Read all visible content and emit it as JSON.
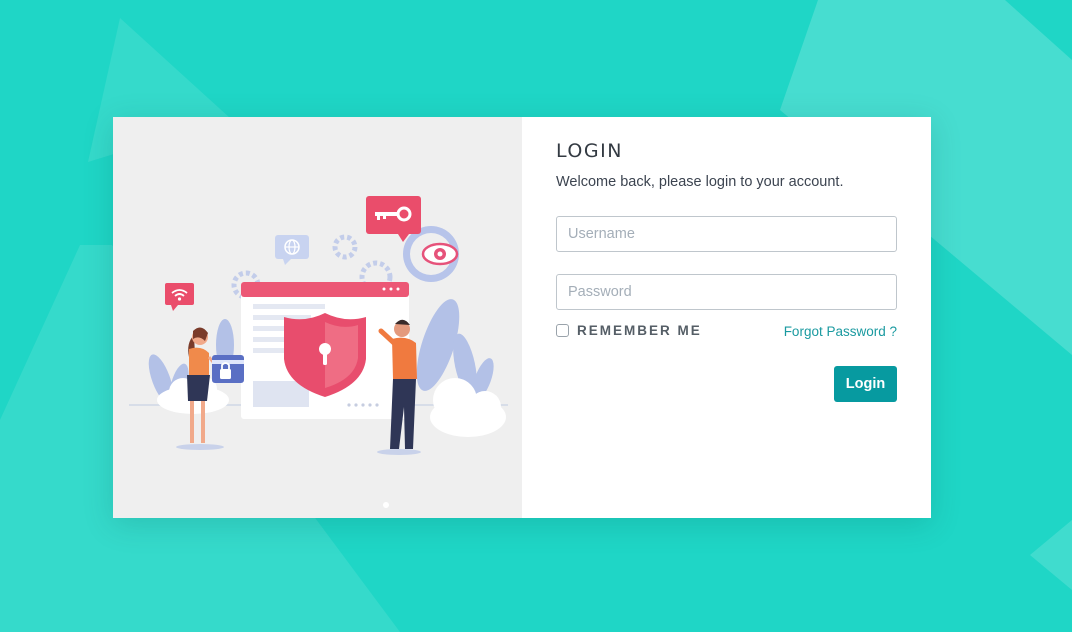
{
  "login": {
    "title": "LOGIN",
    "subtitle": "Welcome back, please login to your account.",
    "username_placeholder": "Username",
    "username_value": "",
    "password_placeholder": "Password",
    "password_value": "",
    "remember_label": "REMEMBER ME",
    "remember_checked": false,
    "forgot_label": "Forgot Password ?",
    "submit_label": "Login"
  },
  "colors": {
    "background": "#1fd6c6",
    "accent": "#079aa0",
    "illustration_pink": "#ea4d6b",
    "illustration_orange": "#f08a4b"
  },
  "illustration": {
    "icons": [
      "key-icon",
      "eye-icon",
      "globe-icon",
      "wifi-icon",
      "shield-lock-icon",
      "gear-icon",
      "padlock-icon"
    ]
  }
}
